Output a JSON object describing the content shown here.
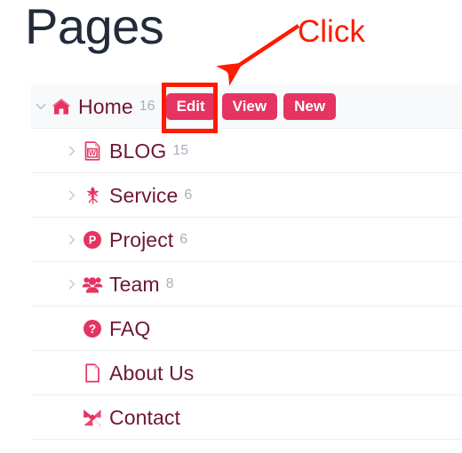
{
  "page": {
    "title": "Pages"
  },
  "colors": {
    "accent_pink": "#e53362",
    "label_maroon": "#6d1733",
    "title_navy": "#222b3a",
    "count_gray": "#a8b0ba",
    "annotation_red": "#ff1a00",
    "active_row_bg": "#f8f9fa",
    "row_divider": "#eceef0"
  },
  "annotation": {
    "click_label": "Click",
    "highlight_target": "edit-button"
  },
  "tree": {
    "rows": [
      {
        "label": "Home",
        "count": "16",
        "icon": "home-icon",
        "twisty": "chevron-down-icon",
        "depth": 1,
        "active": true,
        "actions": [
          {
            "label": "Edit",
            "name": "edit-button"
          },
          {
            "label": "View",
            "name": "view-button"
          },
          {
            "label": "New",
            "name": "new-button"
          }
        ]
      },
      {
        "label": "BLOG",
        "count": "15",
        "icon": "word-file-icon",
        "twisty": "chevron-right-icon",
        "depth": 2,
        "active": false,
        "actions": []
      },
      {
        "label": "Service",
        "count": "6",
        "icon": "leaf-icon",
        "twisty": "chevron-right-icon",
        "depth": 2,
        "active": false,
        "actions": []
      },
      {
        "label": "Project",
        "count": "6",
        "icon": "circle-p-icon",
        "twisty": "chevron-right-icon",
        "depth": 2,
        "active": false,
        "actions": []
      },
      {
        "label": "Team",
        "count": "8",
        "icon": "users-icon",
        "twisty": "chevron-right-icon",
        "depth": 2,
        "active": false,
        "actions": []
      },
      {
        "label": "FAQ",
        "count": "",
        "icon": "question-circle-icon",
        "twisty": "",
        "depth": 2,
        "active": false,
        "actions": []
      },
      {
        "label": "About Us",
        "count": "",
        "icon": "document-icon",
        "twisty": "",
        "depth": 2,
        "active": false,
        "actions": []
      },
      {
        "label": "Contact",
        "count": "",
        "icon": "paper-plane-icon",
        "twisty": "",
        "depth": 2,
        "active": false,
        "actions": []
      }
    ]
  }
}
